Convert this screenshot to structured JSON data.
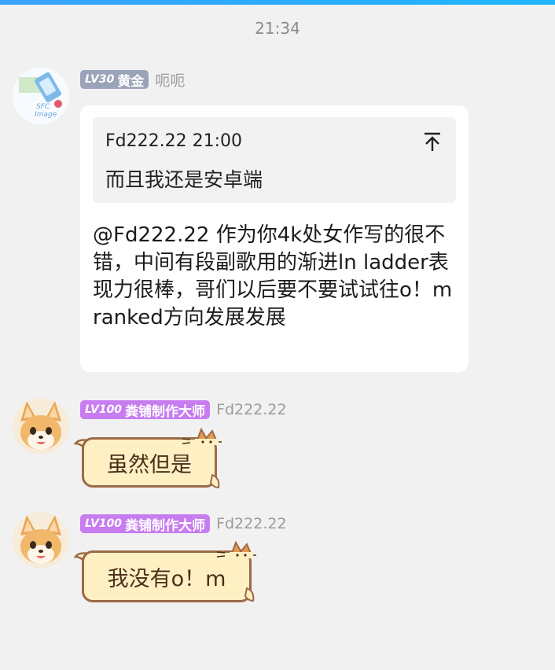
{
  "colors": {
    "background": "#f1f1f1",
    "accent_bar": "#1fb6ff",
    "gold_badge": "#9aa3b8",
    "purple_badge": "#c77cf0",
    "sticker_fill": "#fff0c4",
    "sticker_border": "#9c6a45"
  },
  "time": "21:34",
  "messages": [
    {
      "badge": {
        "level": "LV30",
        "title": "黄金"
      },
      "nickname": "呃呃",
      "avatar": "sfc-image-avatar",
      "quote": {
        "header": "Fd222.22 21:00",
        "body": "而且我还是安卓端",
        "icon": "jump-to-top-icon"
      },
      "text": "@Fd222.22 作为你4k处女作写的很不错，中间有段副歌用的渐进ln ladder表现力很棒，哥们以后要不要试试往o！m ranked方向发展发展"
    },
    {
      "badge": {
        "level": "LV100",
        "title": "粪铺制作大师"
      },
      "nickname": "Fd222.22",
      "avatar": "fox-avatar",
      "text": "虽然但是"
    },
    {
      "badge": {
        "level": "LV100",
        "title": "粪铺制作大师"
      },
      "nickname": "Fd222.22",
      "avatar": "fox-avatar",
      "text": "我没有o！m"
    }
  ]
}
